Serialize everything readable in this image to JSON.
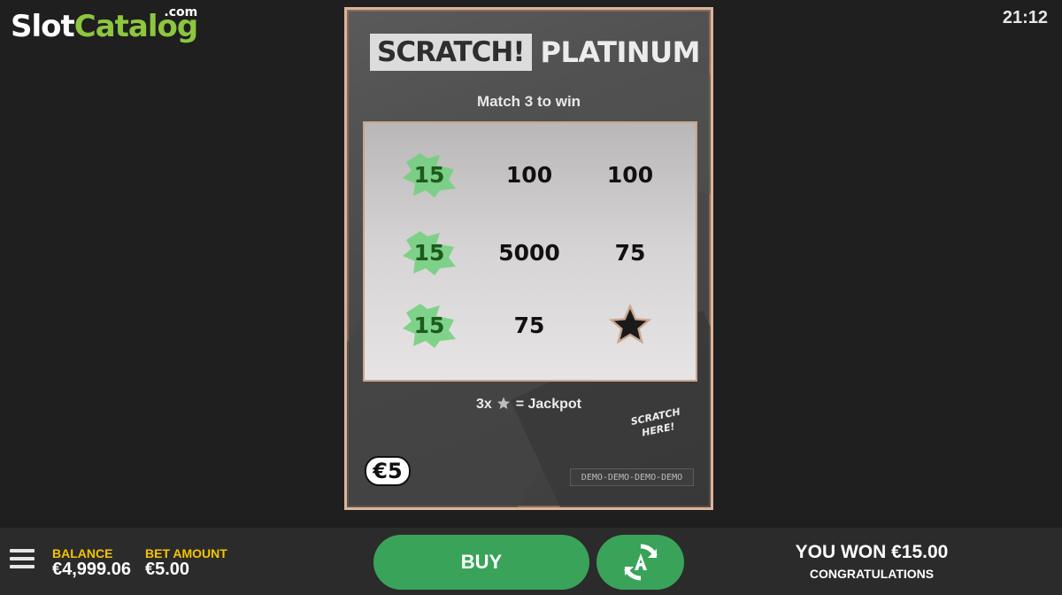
{
  "logo": {
    "slot": "Slot",
    "catalog": "Catalog",
    "com": ".com"
  },
  "clock": "21:12",
  "ticket": {
    "title_box": "SCRATCH!",
    "title_rest": "PLATINUM",
    "subtitle": "Match 3 to win",
    "grid": [
      [
        {
          "value": "15",
          "win": true
        },
        {
          "value": "100",
          "win": false
        },
        {
          "value": "100",
          "win": false
        }
      ],
      [
        {
          "value": "15",
          "win": true
        },
        {
          "value": "5000",
          "win": false
        },
        {
          "value": "75",
          "win": false
        }
      ],
      [
        {
          "value": "15",
          "win": true
        },
        {
          "value": "75",
          "win": false
        },
        {
          "value": "star-icon",
          "win": false,
          "icon": true
        }
      ]
    ],
    "jackpot_prefix": "3x",
    "jackpot_suffix": "= Jackpot",
    "scratch_here_1": "SCRATCH",
    "scratch_here_2": "HERE!",
    "price_badge": "€5",
    "demo_tag": "DEMO-DEMO-DEMO-DEMO"
  },
  "bottom": {
    "balance_label": "BALANCE",
    "balance_value": "€4,999.06",
    "bet_label": "BET AMOUNT",
    "bet_value": "€5.00",
    "buy_label": "BUY",
    "won_text": "YOU WON €15.00",
    "congrats": "CONGRATULATIONS"
  },
  "colors": {
    "accent_green": "#3aa35a",
    "label_yellow": "#f5c400",
    "ticket_border": "#d9b59a",
    "win_splat": "#6fd07a"
  }
}
